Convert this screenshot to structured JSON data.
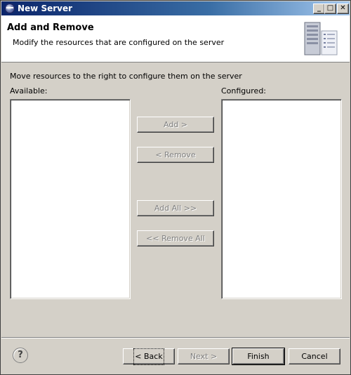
{
  "window": {
    "title": "New Server",
    "controls": {
      "minimize": "_",
      "maximize": "□",
      "close": "✕"
    }
  },
  "header": {
    "title": "Add and Remove",
    "description": "Modify the resources that are configured on the server",
    "graphic": "server-icon"
  },
  "main": {
    "instructions": "Move resources to the right to configure them on the server",
    "available_label": "Available:",
    "configured_label": "Configured:",
    "available_items": [],
    "configured_items": [],
    "buttons": {
      "add": "Add >",
      "remove": "< Remove",
      "add_all": "Add All >>",
      "remove_all": "<< Remove All"
    }
  },
  "footer": {
    "help_icon": "?",
    "back": "< Back",
    "next": "Next >",
    "finish": "Finish",
    "cancel": "Cancel"
  }
}
